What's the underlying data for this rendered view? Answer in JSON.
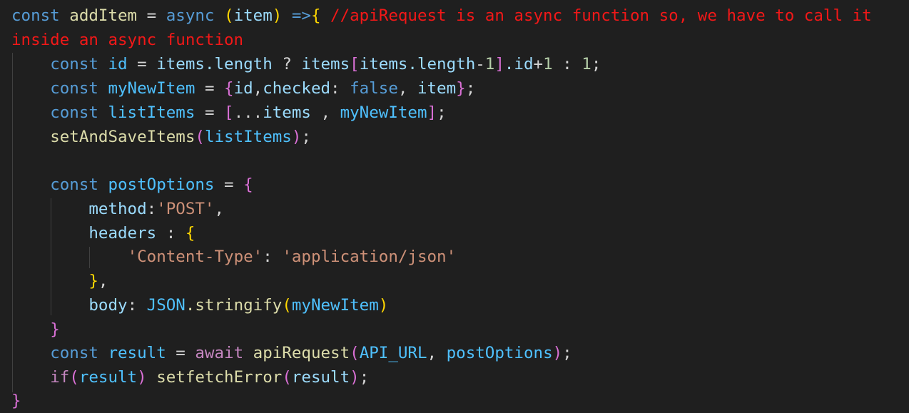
{
  "code": {
    "l1": {
      "kw_const": "const",
      "fn_name": "addItem",
      "eq": "=",
      "kw_async": "async",
      "p_open": "(",
      "param": "item",
      "p_close": ")",
      "arrow": "=>",
      "brace": "{",
      "comment": "//apiRequest is an async function so, we have to call it"
    },
    "l2": {
      "comment": "inside an async function"
    },
    "l3": {
      "kw_const": "const",
      "var_id": "id",
      "eq": "=",
      "items1": "items",
      "length1": ".length",
      "q": "?",
      "items2": "items",
      "br_open": "[",
      "items3": "items",
      "length2": ".length",
      "minus": "-",
      "one1": "1",
      "br_close": "]",
      "id_prop": ".id",
      "plus": "+",
      "one2": "1",
      "colon": ":",
      "one3": "1",
      "semi": ";"
    },
    "l4": {
      "kw_const": "const",
      "var_name": "myNewItem",
      "eq": "=",
      "br_open": "{",
      "id": "id",
      "comma1": ",",
      "checked": "checked",
      "colon": ":",
      "kw_false": "false",
      "comma2": ",",
      "item": "item",
      "br_close": "}",
      "semi": ";"
    },
    "l5": {
      "kw_const": "const",
      "var_name": "listItems",
      "eq": "=",
      "br_open": "[",
      "spread": "...",
      "items": "items",
      "comma": ",",
      "myNewItem": "myNewItem",
      "br_close": "]",
      "semi": ";"
    },
    "l6": {
      "fn": "setAndSaveItems",
      "p_open": "(",
      "arg": "listItems",
      "p_close": ")",
      "semi": ";"
    },
    "l8": {
      "kw_const": "const",
      "var_name": "postOptions",
      "eq": "=",
      "br_open": "{"
    },
    "l9": {
      "key": "method",
      "colon": ":",
      "value": "'POST'",
      "comma": ","
    },
    "l10": {
      "key": "headers",
      "colon": ":",
      "br_open": "{"
    },
    "l11": {
      "key": "'Content-Type'",
      "colon": ":",
      "value": "'application/json'"
    },
    "l12": {
      "br_close": "}",
      "comma": ","
    },
    "l13": {
      "key": "body",
      "colon": ":",
      "obj": "JSON",
      "method": ".stringify",
      "p_open": "(",
      "arg": "myNewItem",
      "p_close": ")"
    },
    "l14": {
      "br_close": "}"
    },
    "l15": {
      "kw_const": "const",
      "var_name": "result",
      "eq": "=",
      "kw_await": "await",
      "fn": "apiRequest",
      "p_open": "(",
      "arg1": "API_URL",
      "comma": ",",
      "arg2": "postOptions",
      "p_close": ")",
      "semi": ";"
    },
    "l16": {
      "kw_if": "if",
      "p_open": "(",
      "cond": "result",
      "p_close": ")",
      "fn": "setfetchError",
      "p2_open": "(",
      "arg": "result",
      "p2_close": ")",
      "semi": ";"
    },
    "l17": {
      "br_close": "}"
    }
  },
  "colors": {
    "background": "#1f1f1f",
    "keyword": "#569cd6",
    "control": "#c586c0",
    "variable": "#9cdcfe",
    "function": "#dcdcaa",
    "number": "#b5cea8",
    "string": "#ce9178",
    "constant": "#4fc1ff",
    "comment": "#f21818",
    "bracket_gold": "#ffd700",
    "bracket_pink": "#da70d6",
    "bracket_blue": "#179fff"
  }
}
